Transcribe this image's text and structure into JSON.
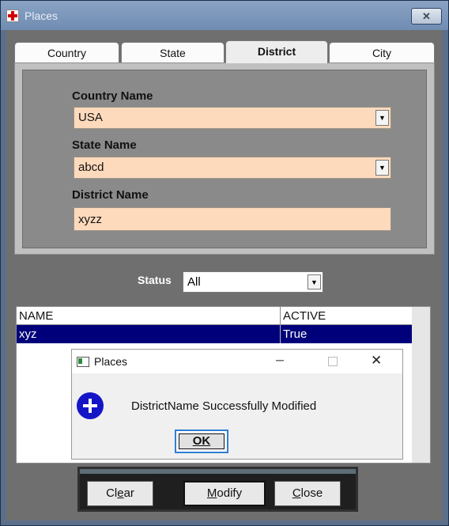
{
  "window": {
    "title": "Places",
    "close_label": "✕"
  },
  "tabs": [
    {
      "label": "Country",
      "active": false
    },
    {
      "label": "State",
      "active": false
    },
    {
      "label": "District",
      "active": true
    },
    {
      "label": "City",
      "active": false
    }
  ],
  "form": {
    "country_label": "Country Name",
    "country_value": "USA",
    "state_label": "State Name",
    "state_value": "abcd",
    "district_label": "District Name",
    "district_value": "xyzz"
  },
  "filter": {
    "status_label": "Status",
    "status_value": "All"
  },
  "grid": {
    "columns": [
      "NAME",
      "ACTIVE"
    ],
    "rows": [
      {
        "name": "xyz",
        "active": "True"
      }
    ]
  },
  "message_box": {
    "title": "Places",
    "text": "DistrictName Successfully Modified",
    "ok_label": "OK"
  },
  "buttons": {
    "clear_pre": "Cl",
    "clear_ul": "e",
    "clear_post": "ar",
    "modify_ul": "M",
    "modify_post": "odify",
    "close_ul": "C",
    "close_post": "lose"
  },
  "colors": {
    "input_background": "#fedabd",
    "selected_row": "#00007a",
    "info_icon": "#1515c8",
    "default_button_border": "#2f7fd3"
  }
}
